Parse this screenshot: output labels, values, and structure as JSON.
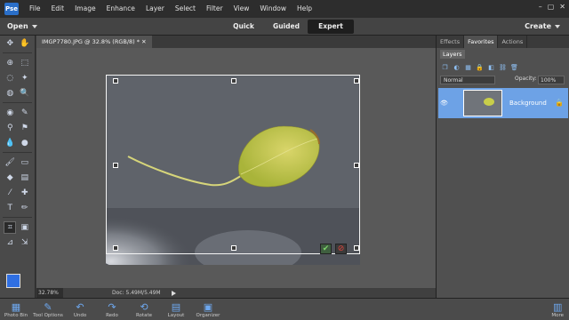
{
  "menubar": {
    "app_icon": "Pse",
    "items": [
      "File",
      "Edit",
      "Image",
      "Enhance",
      "Layer",
      "Select",
      "Filter",
      "View",
      "Window",
      "Help"
    ]
  },
  "modebar": {
    "open_label": "Open",
    "modes": [
      "Quick",
      "Guided",
      "Expert"
    ],
    "active_mode": "Expert",
    "create_label": "Create"
  },
  "document": {
    "tab_title": "IMGP7780.JPG @ 32.8% (RGB/8) *",
    "zoom": "32.78%",
    "doc_info": "Doc: 5.49M/5.49M"
  },
  "panel": {
    "tabs": [
      "Effects",
      "Favorites",
      "Actions"
    ],
    "active_tab": "Favorites",
    "subtab": "Layers",
    "blend_mode": "Normal",
    "opacity_label": "Opacity:",
    "opacity_value": "100%",
    "layer_name": "Background"
  },
  "taskbar": {
    "items": [
      "Photo Bin",
      "Tool Options",
      "Undo",
      "Redo",
      "Rotate",
      "Layout",
      "Organizer"
    ],
    "more_label": "More"
  },
  "colors": {
    "accent": "#2f6fe3",
    "layer_selected": "#6da2e6",
    "confirm": "#7dd26b",
    "cancel": "#e0433a"
  }
}
